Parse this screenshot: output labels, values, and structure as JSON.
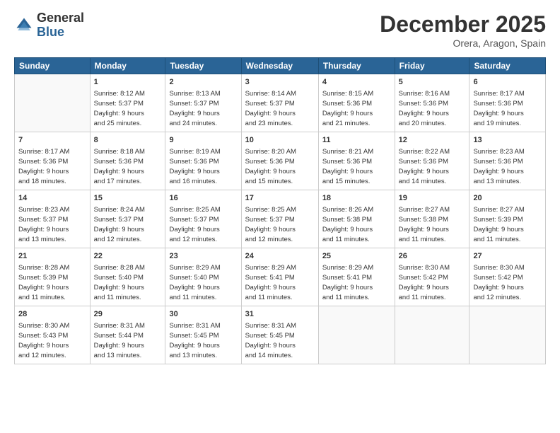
{
  "logo": {
    "general": "General",
    "blue": "Blue"
  },
  "title": "December 2025",
  "location": "Orera, Aragon, Spain",
  "weekdays": [
    "Sunday",
    "Monday",
    "Tuesday",
    "Wednesday",
    "Thursday",
    "Friday",
    "Saturday"
  ],
  "weeks": [
    [
      {
        "day": null,
        "info": null
      },
      {
        "day": "1",
        "info": "Sunrise: 8:12 AM\nSunset: 5:37 PM\nDaylight: 9 hours\nand 25 minutes."
      },
      {
        "day": "2",
        "info": "Sunrise: 8:13 AM\nSunset: 5:37 PM\nDaylight: 9 hours\nand 24 minutes."
      },
      {
        "day": "3",
        "info": "Sunrise: 8:14 AM\nSunset: 5:37 PM\nDaylight: 9 hours\nand 23 minutes."
      },
      {
        "day": "4",
        "info": "Sunrise: 8:15 AM\nSunset: 5:36 PM\nDaylight: 9 hours\nand 21 minutes."
      },
      {
        "day": "5",
        "info": "Sunrise: 8:16 AM\nSunset: 5:36 PM\nDaylight: 9 hours\nand 20 minutes."
      },
      {
        "day": "6",
        "info": "Sunrise: 8:17 AM\nSunset: 5:36 PM\nDaylight: 9 hours\nand 19 minutes."
      }
    ],
    [
      {
        "day": "7",
        "info": "Sunrise: 8:17 AM\nSunset: 5:36 PM\nDaylight: 9 hours\nand 18 minutes."
      },
      {
        "day": "8",
        "info": "Sunrise: 8:18 AM\nSunset: 5:36 PM\nDaylight: 9 hours\nand 17 minutes."
      },
      {
        "day": "9",
        "info": "Sunrise: 8:19 AM\nSunset: 5:36 PM\nDaylight: 9 hours\nand 16 minutes."
      },
      {
        "day": "10",
        "info": "Sunrise: 8:20 AM\nSunset: 5:36 PM\nDaylight: 9 hours\nand 15 minutes."
      },
      {
        "day": "11",
        "info": "Sunrise: 8:21 AM\nSunset: 5:36 PM\nDaylight: 9 hours\nand 15 minutes."
      },
      {
        "day": "12",
        "info": "Sunrise: 8:22 AM\nSunset: 5:36 PM\nDaylight: 9 hours\nand 14 minutes."
      },
      {
        "day": "13",
        "info": "Sunrise: 8:23 AM\nSunset: 5:36 PM\nDaylight: 9 hours\nand 13 minutes."
      }
    ],
    [
      {
        "day": "14",
        "info": "Sunrise: 8:23 AM\nSunset: 5:37 PM\nDaylight: 9 hours\nand 13 minutes."
      },
      {
        "day": "15",
        "info": "Sunrise: 8:24 AM\nSunset: 5:37 PM\nDaylight: 9 hours\nand 12 minutes."
      },
      {
        "day": "16",
        "info": "Sunrise: 8:25 AM\nSunset: 5:37 PM\nDaylight: 9 hours\nand 12 minutes."
      },
      {
        "day": "17",
        "info": "Sunrise: 8:25 AM\nSunset: 5:37 PM\nDaylight: 9 hours\nand 12 minutes."
      },
      {
        "day": "18",
        "info": "Sunrise: 8:26 AM\nSunset: 5:38 PM\nDaylight: 9 hours\nand 11 minutes."
      },
      {
        "day": "19",
        "info": "Sunrise: 8:27 AM\nSunset: 5:38 PM\nDaylight: 9 hours\nand 11 minutes."
      },
      {
        "day": "20",
        "info": "Sunrise: 8:27 AM\nSunset: 5:39 PM\nDaylight: 9 hours\nand 11 minutes."
      }
    ],
    [
      {
        "day": "21",
        "info": "Sunrise: 8:28 AM\nSunset: 5:39 PM\nDaylight: 9 hours\nand 11 minutes."
      },
      {
        "day": "22",
        "info": "Sunrise: 8:28 AM\nSunset: 5:40 PM\nDaylight: 9 hours\nand 11 minutes."
      },
      {
        "day": "23",
        "info": "Sunrise: 8:29 AM\nSunset: 5:40 PM\nDaylight: 9 hours\nand 11 minutes."
      },
      {
        "day": "24",
        "info": "Sunrise: 8:29 AM\nSunset: 5:41 PM\nDaylight: 9 hours\nand 11 minutes."
      },
      {
        "day": "25",
        "info": "Sunrise: 8:29 AM\nSunset: 5:41 PM\nDaylight: 9 hours\nand 11 minutes."
      },
      {
        "day": "26",
        "info": "Sunrise: 8:30 AM\nSunset: 5:42 PM\nDaylight: 9 hours\nand 11 minutes."
      },
      {
        "day": "27",
        "info": "Sunrise: 8:30 AM\nSunset: 5:42 PM\nDaylight: 9 hours\nand 12 minutes."
      }
    ],
    [
      {
        "day": "28",
        "info": "Sunrise: 8:30 AM\nSunset: 5:43 PM\nDaylight: 9 hours\nand 12 minutes."
      },
      {
        "day": "29",
        "info": "Sunrise: 8:31 AM\nSunset: 5:44 PM\nDaylight: 9 hours\nand 13 minutes."
      },
      {
        "day": "30",
        "info": "Sunrise: 8:31 AM\nSunset: 5:45 PM\nDaylight: 9 hours\nand 13 minutes."
      },
      {
        "day": "31",
        "info": "Sunrise: 8:31 AM\nSunset: 5:45 PM\nDaylight: 9 hours\nand 14 minutes."
      },
      {
        "day": null,
        "info": null
      },
      {
        "day": null,
        "info": null
      },
      {
        "day": null,
        "info": null
      }
    ]
  ]
}
